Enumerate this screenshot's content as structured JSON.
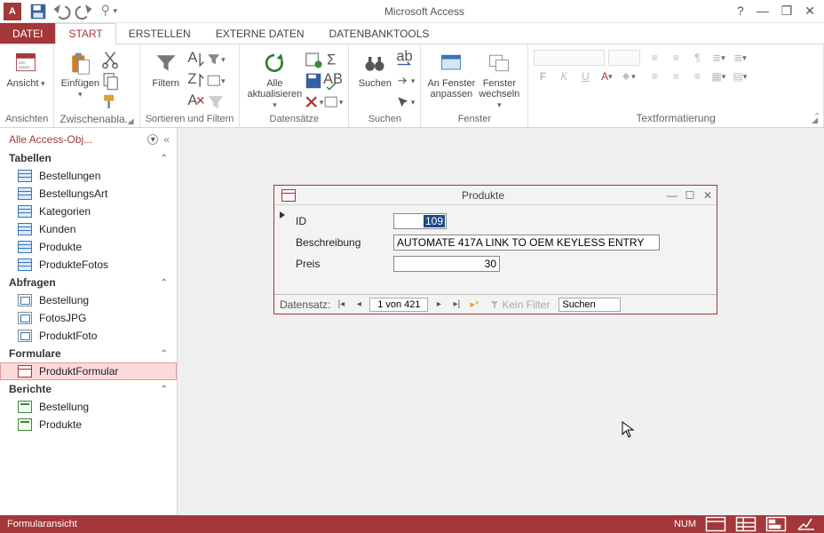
{
  "app": {
    "title": "Microsoft Access"
  },
  "tabs": {
    "file": "DATEI",
    "start": "START",
    "erstellen": "ERSTELLEN",
    "externe": "EXTERNE DATEN",
    "dbtools": "DATENBANKTOOLS"
  },
  "ribbon": {
    "ansichten": {
      "label": "Ansichten",
      "ansicht": "Ansicht"
    },
    "clipboard": {
      "label": "Zwischenabla...",
      "einfuegen": "Einfügen"
    },
    "sort": {
      "label": "Sortieren und Filtern",
      "filtern": "Filtern"
    },
    "records": {
      "label": "Datensätze",
      "alle_akt": "Alle\naktualisieren"
    },
    "find": {
      "label": "Suchen",
      "suchen": "Suchen"
    },
    "window": {
      "label": "Fenster",
      "anpassen": "An Fenster\nanpassen",
      "wechseln": "Fenster\nwechseln"
    },
    "textfmt": {
      "label": "Textformatierung"
    }
  },
  "nav": {
    "title": "Alle Access-Obj...",
    "groups": {
      "tabellen": "Tabellen",
      "abfragen": "Abfragen",
      "formulare": "Formulare",
      "berichte": "Berichte"
    },
    "tables": [
      "Bestellungen",
      "BestellungsArt",
      "Kategorien",
      "Kunden",
      "Produkte",
      "ProdukteFotos"
    ],
    "queries": [
      "Bestellung",
      "FotosJPG",
      "ProduktFoto"
    ],
    "forms": [
      "ProduktFormular"
    ],
    "reports": [
      "Bestellung",
      "Produkte"
    ]
  },
  "form": {
    "title": "Produkte",
    "fields": {
      "id_label": "ID",
      "id_value": "109",
      "beschr_label": "Beschreibung",
      "beschr_value": "AUTOMATE 417A LINK TO OEM KEYLESS ENTRY",
      "preis_label": "Preis",
      "preis_value": "30"
    },
    "recnav": {
      "label": "Datensatz:",
      "position": "1 von 421",
      "filter": "Kein Filter",
      "search": "Suchen"
    }
  },
  "status": {
    "view": "Formularansicht",
    "num": "NUM"
  }
}
